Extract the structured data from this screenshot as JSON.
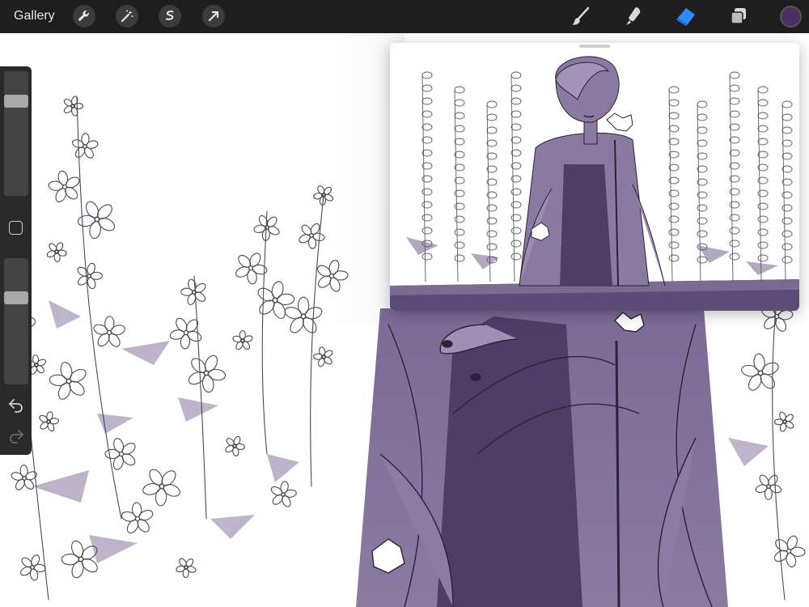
{
  "toolbar": {
    "gallery_label": "Gallery",
    "left_tools": [
      "wrench-icon",
      "magic-wand-icon",
      "selection-icon",
      "transform-arrow-icon"
    ],
    "right_tools": [
      "brush-icon",
      "smudge-icon",
      "eraser-icon",
      "layers-icon"
    ],
    "active_tool": "eraser-icon",
    "active_color": "#4a3163",
    "accent": "#2f8cff"
  },
  "sidebar": {
    "brush_size_level": 0.79,
    "opacity_level": 0.71
  },
  "canvas": {
    "palette": [
      "#ffffff",
      "#9d8fb0",
      "#5e4a78",
      "#3e2d55"
    ]
  },
  "reference": {
    "visible": true
  }
}
